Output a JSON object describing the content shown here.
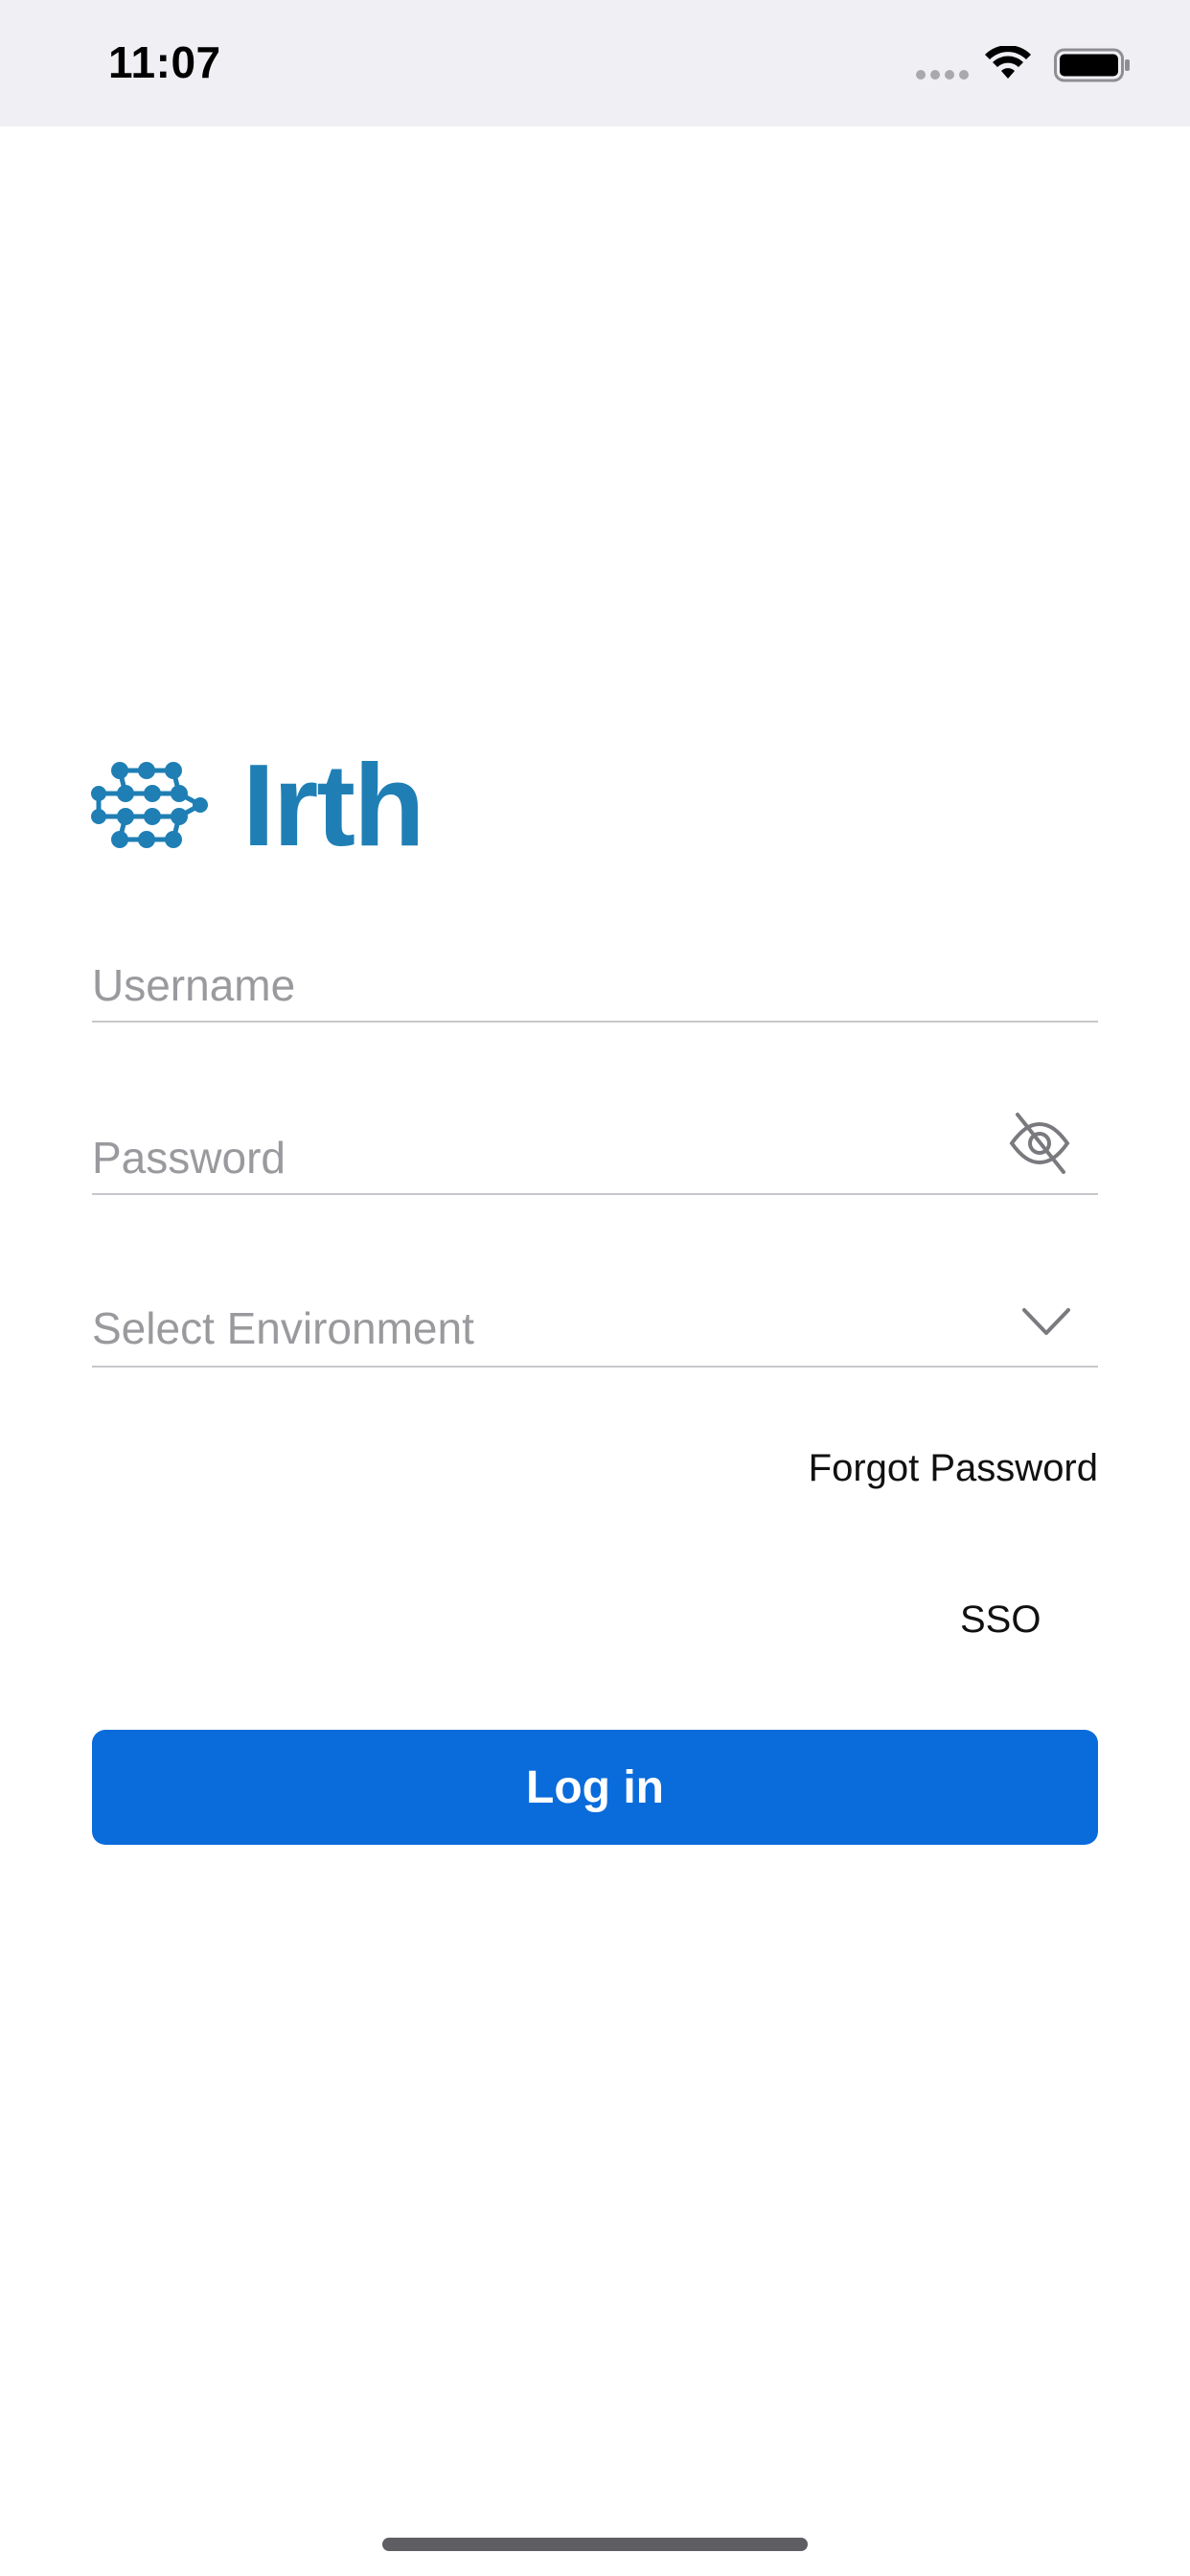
{
  "status_bar": {
    "time": "11:07"
  },
  "brand": {
    "name": "Irth",
    "color": "#1f7fb5",
    "icon": "irth-logo-icon"
  },
  "form": {
    "username": {
      "placeholder": "Username",
      "value": ""
    },
    "password": {
      "placeholder": "Password",
      "value": "",
      "toggle_icon": "eye-slash-icon"
    },
    "environment": {
      "selected": "Select Environment",
      "icon": "chevron-down-icon"
    }
  },
  "links": {
    "forgot_password": "Forgot Password",
    "sso": "SSO"
  },
  "login_button": {
    "label": "Log in",
    "color": "#0a6bdb"
  }
}
